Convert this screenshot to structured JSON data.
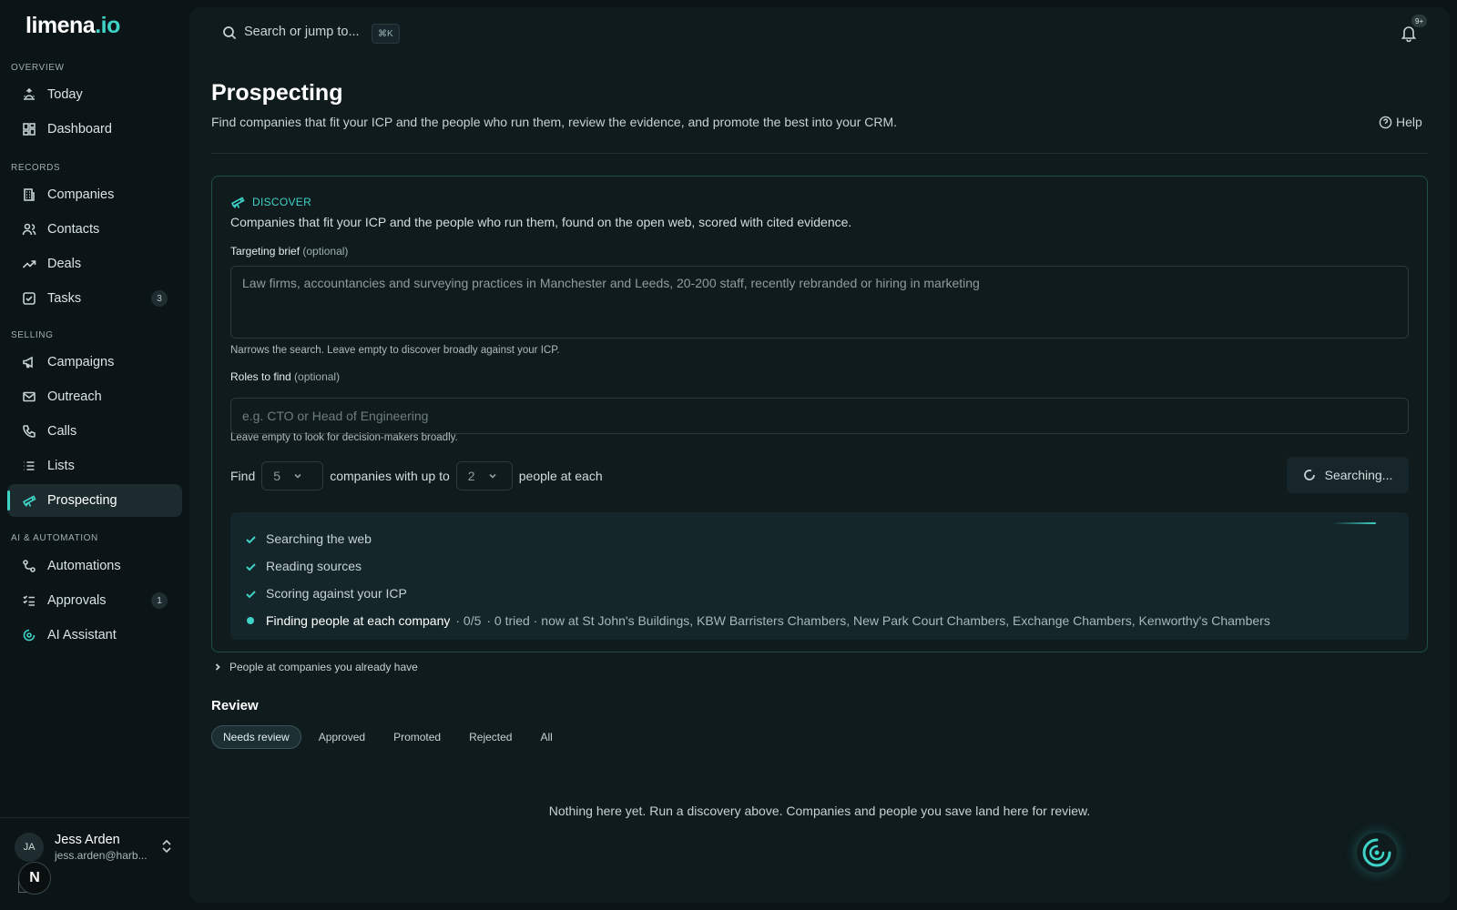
{
  "brand": {
    "name_main": "limena",
    "name_accent": ".io",
    "accent_color": "#3fd2c7"
  },
  "sidebar": {
    "sections": [
      {
        "label": "OVERVIEW",
        "items": [
          {
            "label": "Today",
            "icon": "sunrise-icon"
          },
          {
            "label": "Dashboard",
            "icon": "grid-icon"
          }
        ]
      },
      {
        "label": "RECORDS",
        "items": [
          {
            "label": "Companies",
            "icon": "building-icon"
          },
          {
            "label": "Contacts",
            "icon": "users-icon"
          },
          {
            "label": "Deals",
            "icon": "trend-icon"
          },
          {
            "label": "Tasks",
            "icon": "checkbox-icon",
            "badge": "3"
          }
        ]
      },
      {
        "label": "SELLING",
        "items": [
          {
            "label": "Campaigns",
            "icon": "megaphone-icon"
          },
          {
            "label": "Outreach",
            "icon": "mail-icon"
          },
          {
            "label": "Calls",
            "icon": "phone-icon"
          },
          {
            "label": "Lists",
            "icon": "list-icon"
          },
          {
            "label": "Prospecting",
            "icon": "telescope-icon",
            "active": true
          }
        ]
      },
      {
        "label": "AI & AUTOMATION",
        "items": [
          {
            "label": "Automations",
            "icon": "workflow-icon"
          },
          {
            "label": "Approvals",
            "icon": "checklist-icon",
            "badge": "1"
          },
          {
            "label": "AI Assistant",
            "icon": "assistant-icon"
          }
        ]
      }
    ],
    "user": {
      "initials": "JA",
      "name": "Jess Arden",
      "email": "jess.arden@harb..."
    },
    "dev_badge": "N"
  },
  "topbar": {
    "search_placeholder": "Search or jump to...",
    "shortcut": "⌘K",
    "notification_count": "9+"
  },
  "page": {
    "title": "Prospecting",
    "subtitle": "Find companies that fit your ICP and the people who run them, review the evidence, and promote the best into your CRM.",
    "help_label": "Help"
  },
  "discover": {
    "label": "DISCOVER",
    "description": "Companies that fit your ICP and the people who run them, found on the open web, scored with cited evidence.",
    "brief_label": "Targeting brief",
    "optional": "(optional)",
    "brief_value": "Law firms, accountancies and surveying practices in Manchester and Leeds, 20-200 staff, recently rebranded or hiring in marketing",
    "brief_hint": "Narrows the search. Leave empty to discover broadly against your ICP.",
    "roles_label": "Roles to find",
    "roles_placeholder": "e.g. CTO or Head of Engineering",
    "roles_hint": "Leave empty to look for decision-makers broadly.",
    "find_prefix": "Find",
    "company_count": "5",
    "find_middle": "companies with up to",
    "people_count": "2",
    "find_suffix": "people at each",
    "searching_label": "Searching...",
    "steps": [
      {
        "label": "Searching the web",
        "status": "done"
      },
      {
        "label": "Reading sources",
        "status": "done"
      },
      {
        "label": "Scoring against your ICP",
        "status": "done"
      },
      {
        "label": "Finding people at each company",
        "status": "active",
        "progress": "· 0/5",
        "meta": "· 0 tried · now at St John's Buildings, KBW Barristers Chambers, New Park Court Chambers, Exchange Chambers, Kenworthy's Chambers"
      }
    ]
  },
  "existing_people_toggle": "People at companies you already have",
  "review": {
    "title": "Review",
    "tabs": [
      "Needs review",
      "Approved",
      "Promoted",
      "Rejected",
      "All"
    ],
    "active_tab": "Needs review",
    "empty_message": "Nothing here yet. Run a discovery above. Companies and people you save land here for review."
  }
}
